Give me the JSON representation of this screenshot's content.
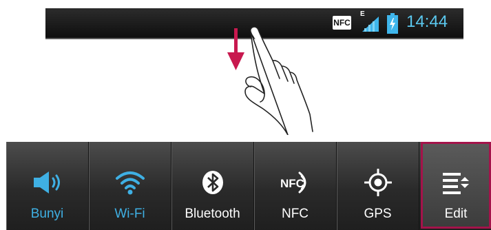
{
  "status_bar": {
    "nfc_badge": "NFC",
    "network_type": "E",
    "time": "14:44",
    "icons": [
      "nfc-icon",
      "signal-icon",
      "battery-charging-icon"
    ]
  },
  "gesture": {
    "icons": [
      "swipe-down-arrow-icon",
      "pointing-hand-icon"
    ],
    "arrow_color": "#c8194f"
  },
  "quick_settings": {
    "tiles": [
      {
        "label": "Bunyi",
        "icon": "sound-icon",
        "active": true
      },
      {
        "label": "Wi-Fi",
        "icon": "wifi-icon",
        "active": true
      },
      {
        "label": "Bluetooth",
        "icon": "bluetooth-icon",
        "active": false
      },
      {
        "label": "NFC",
        "icon": "nfc-icon",
        "active": false
      },
      {
        "label": "GPS",
        "icon": "gps-icon",
        "active": false
      },
      {
        "label": "Edit",
        "icon": "edit-list-icon",
        "active": false
      }
    ],
    "active_color": "#3fb0e4",
    "highlight_color": "#a4134a"
  }
}
